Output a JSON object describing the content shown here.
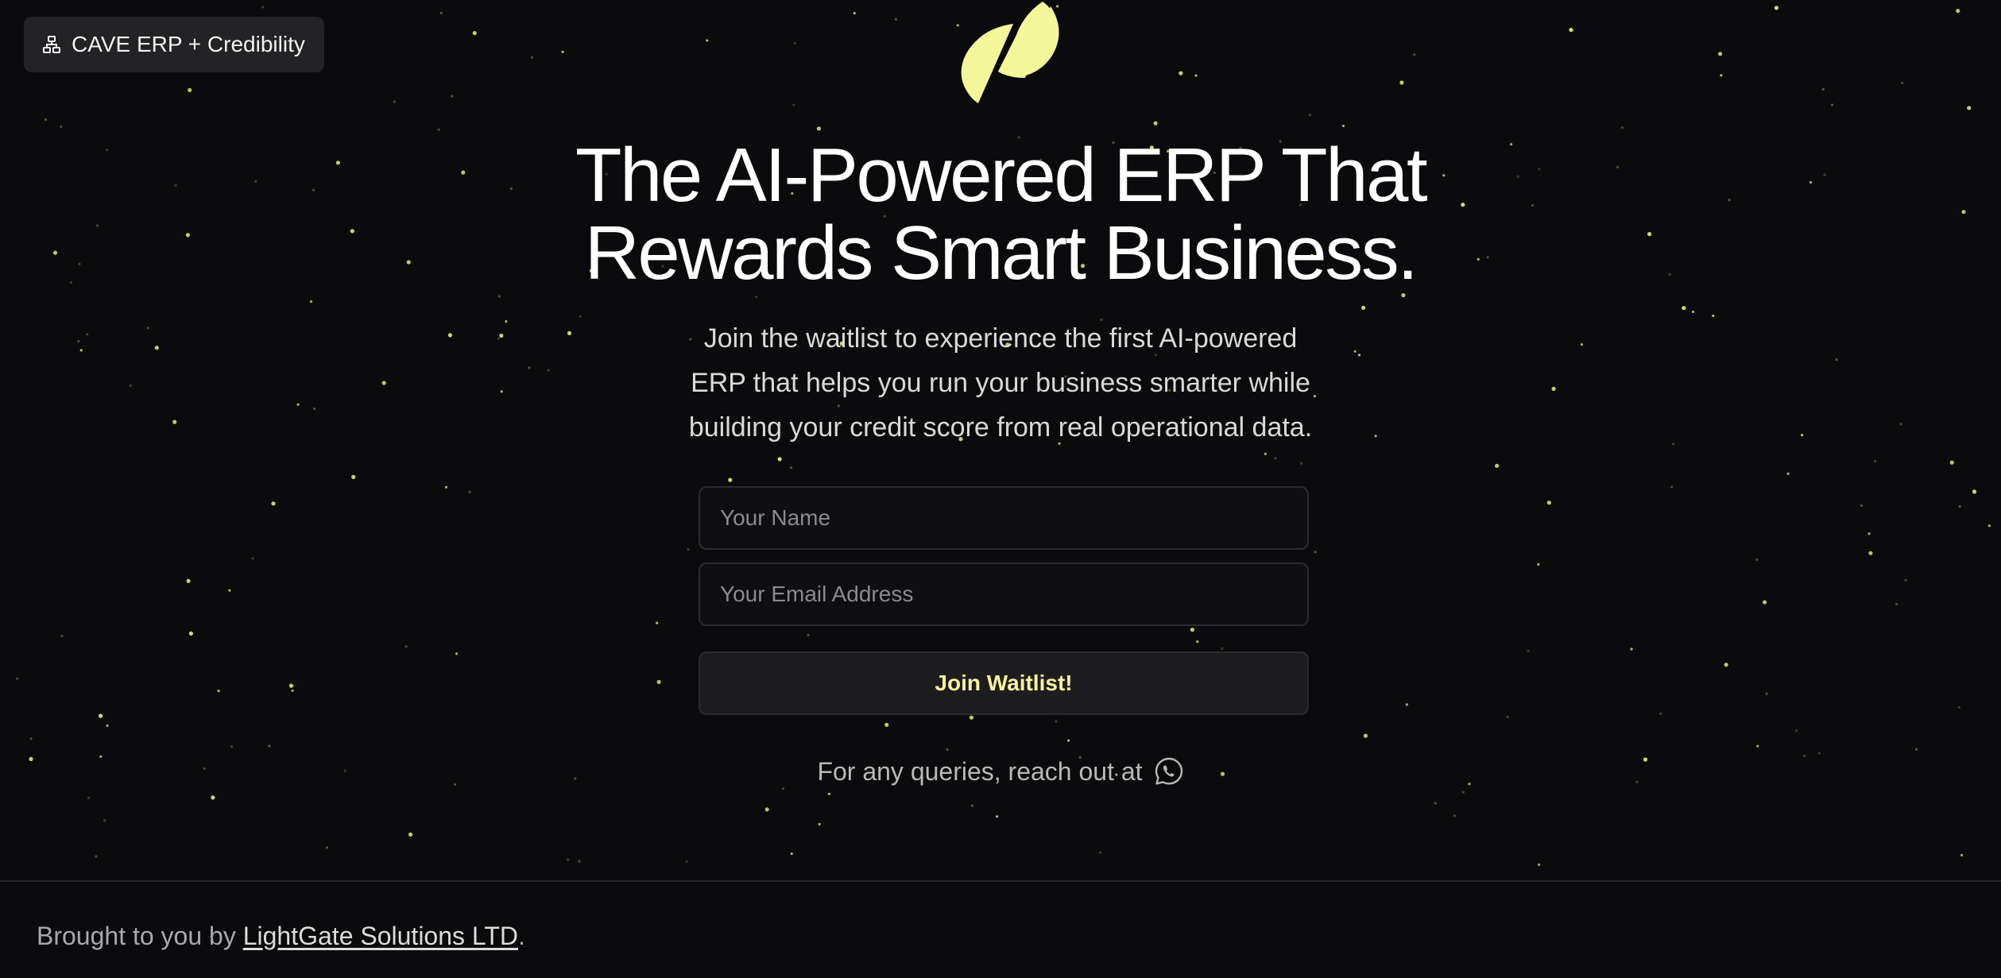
{
  "badge": {
    "icon": "sitemap-icon",
    "label": "CAVE ERP + Credibility"
  },
  "logo": {
    "icon": "brand-logo-icon",
    "color": "#f3f79a"
  },
  "hero": {
    "title_line1": "The AI-Powered ERP That",
    "title_line2": "Rewards Smart Business.",
    "subtitle_line1": "Join the waitlist to experience the first AI-powered",
    "subtitle_line2": "ERP that helps you run your business smarter while",
    "subtitle_line3": "building your credit score from real operational data."
  },
  "form": {
    "name_placeholder": "Your Name",
    "name_value": "",
    "email_placeholder": "Your Email Address",
    "email_value": "",
    "submit_label": "Join Waitlist!"
  },
  "contact": {
    "text": "For any queries, reach out at",
    "icon": "whatsapp-icon"
  },
  "footer": {
    "prefix": "Brought to you by",
    "company_link": "LightGate Solutions LTD",
    "suffix": "."
  },
  "colors": {
    "background": "#0b0b0d",
    "accent": "#f3f79a",
    "star": "#d6dc6a"
  }
}
